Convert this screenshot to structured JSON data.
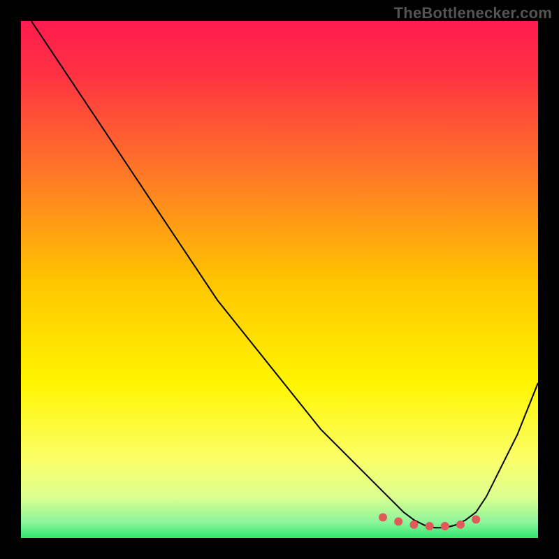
{
  "watermark": "TheBottlenecker.com",
  "chart_data": {
    "type": "line",
    "title": "",
    "xlabel": "",
    "ylabel": "",
    "xlim": [
      0,
      100
    ],
    "ylim": [
      0,
      100
    ],
    "grid": false,
    "legend": false,
    "background_gradient": {
      "stops": [
        {
          "offset": 0.0,
          "color": "#ff1b4f"
        },
        {
          "offset": 0.1,
          "color": "#ff3143"
        },
        {
          "offset": 0.3,
          "color": "#ff7a26"
        },
        {
          "offset": 0.5,
          "color": "#ffc400"
        },
        {
          "offset": 0.7,
          "color": "#fff500"
        },
        {
          "offset": 0.85,
          "color": "#faff6a"
        },
        {
          "offset": 0.92,
          "color": "#dcff90"
        },
        {
          "offset": 0.97,
          "color": "#8cf59a"
        },
        {
          "offset": 1.0,
          "color": "#2ee66e"
        }
      ]
    },
    "series": [
      {
        "name": "bottleneck-curve",
        "color": "#000000",
        "stroke_width": 2,
        "x": [
          2,
          6,
          10,
          14,
          18,
          22,
          26,
          30,
          34,
          38,
          42,
          46,
          50,
          54,
          58,
          62,
          66,
          70,
          72,
          74,
          76,
          78,
          80,
          82,
          84,
          86,
          88,
          90,
          92,
          96,
          100
        ],
        "y": [
          100,
          94,
          88,
          82,
          76,
          70,
          64,
          58,
          52,
          46,
          41,
          36,
          31,
          26,
          21,
          17,
          13,
          9,
          7,
          5,
          3.5,
          2.5,
          2,
          2,
          2.5,
          3.5,
          5,
          8,
          12,
          20,
          30
        ]
      }
    ],
    "markers": {
      "name": "optimal-range",
      "color": "#e05a5a",
      "radius": 6,
      "points_x": [
        70,
        73,
        76,
        79,
        82,
        85,
        88
      ],
      "points_y": [
        4.0,
        3.2,
        2.6,
        2.3,
        2.3,
        2.6,
        3.6
      ]
    }
  }
}
